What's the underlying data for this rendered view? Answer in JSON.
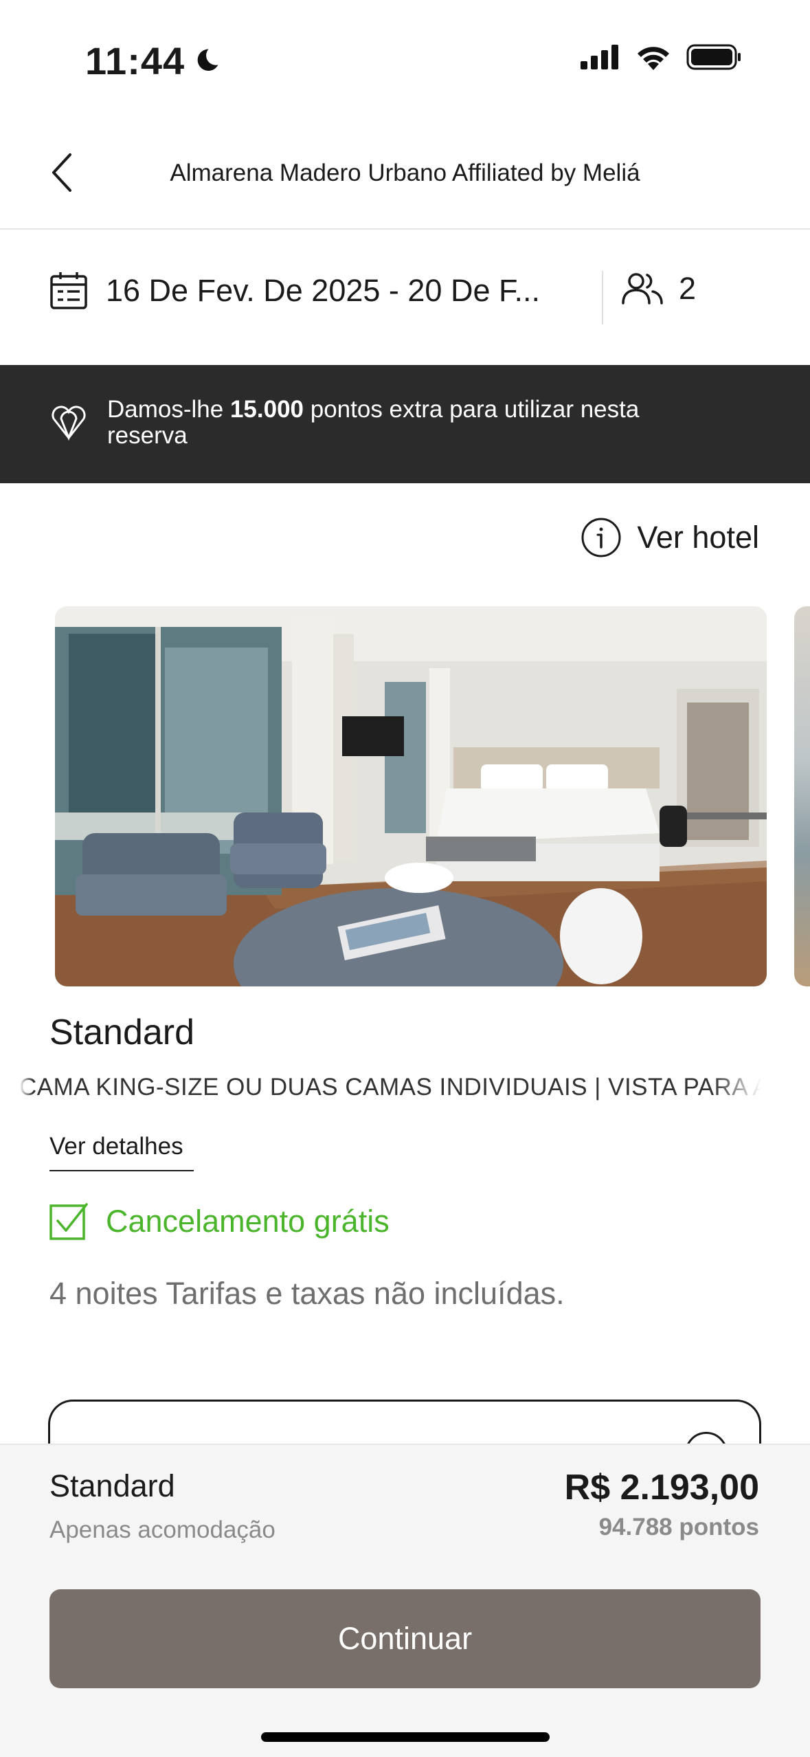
{
  "status_bar": {
    "time": "11:44"
  },
  "header": {
    "title": "Almarena Madero Urbano Affiliated by Meliá"
  },
  "search": {
    "dates": "16 De Fev. De 2025 - 20 De F...",
    "guests": "2"
  },
  "promo": {
    "text_before": "Damos-lhe ",
    "points": "15.000",
    "text_after": " pontos extra para utilizar nesta reserva"
  },
  "ver_hotel": {
    "label": "Ver hotel"
  },
  "room": {
    "name": "Standard",
    "features": "CAMA KING-SIZE OU DUAS CAMAS INDIVIDUAIS  |  VISTA PARA A CIDADE",
    "details_link": "Ver detalhes",
    "cancellation": "Cancelamento grátis",
    "nights_note": "4 noites Tarifas e taxas não incluídas."
  },
  "summary": {
    "room": "Standard",
    "subtitle": "Apenas acomodação",
    "price": "R$ 2.193,00",
    "points": "94.788 pontos",
    "continue_label": "Continuar"
  },
  "colors": {
    "accent_green": "#4ab52a",
    "banner_dark": "#2b2b2b",
    "button": "#786f6a"
  },
  "icons": [
    "moon-icon",
    "cellular-signal-icon",
    "wifi-icon",
    "battery-icon",
    "back-chevron-icon",
    "calendar-icon",
    "guests-icon",
    "melia-logo-icon",
    "info-icon",
    "checkbox-check-icon"
  ]
}
